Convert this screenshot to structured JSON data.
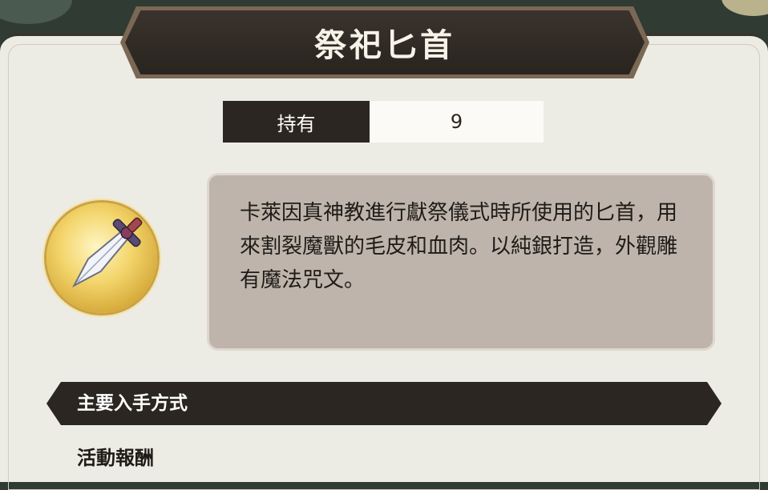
{
  "item": {
    "name": "祭祀匕首",
    "owned_label": "持有",
    "owned_count": "9",
    "icon": "ritual-dagger-icon",
    "description": "卡萊因真神教進行獻祭儀式時所使用的匕首，用來割裂魔獸的毛皮和血肉。以純銀打造，外觀雕有魔法咒文。"
  },
  "sources": {
    "title": "主要入手方式",
    "items": [
      "活動報酬"
    ]
  },
  "colors": {
    "panel_bg": "#ecebe4",
    "dark_plate": "#2b2621",
    "desc_box": "#beb4ab",
    "coin_gold": "#e8c14f"
  }
}
